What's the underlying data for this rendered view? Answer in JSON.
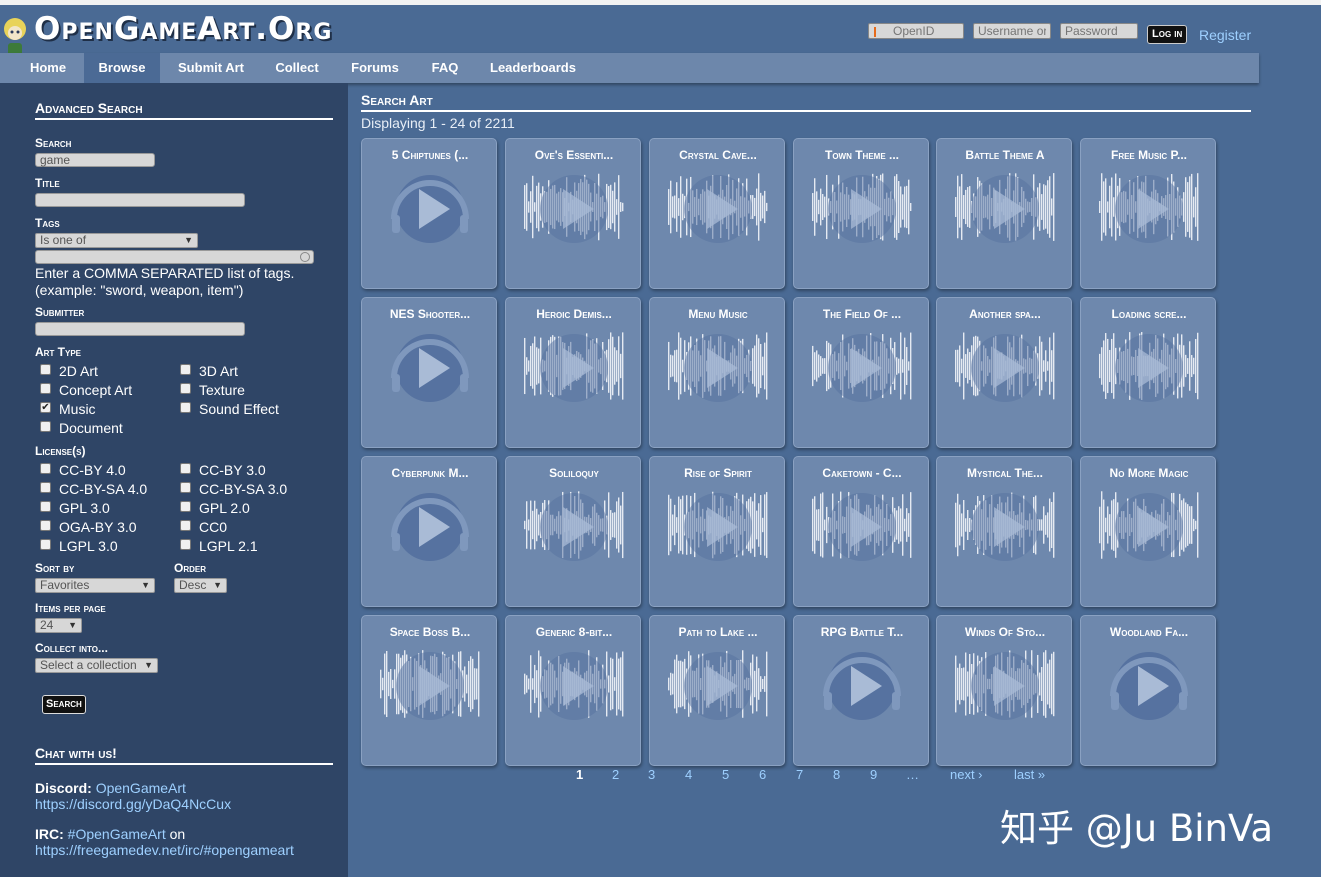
{
  "site": {
    "logo": "OpenGameArt.Org"
  },
  "login": {
    "openid_placeholder": "OpenID",
    "username_placeholder": "Username or",
    "password_placeholder": "Password",
    "login_label": "Log in",
    "register_label": "Register"
  },
  "nav": {
    "items": [
      {
        "label": "Home"
      },
      {
        "label": "Browse"
      },
      {
        "label": "Submit Art"
      },
      {
        "label": "Collect"
      },
      {
        "label": "Forums"
      },
      {
        "label": "FAQ"
      },
      {
        "label": "Leaderboards"
      }
    ],
    "active": "Browse"
  },
  "sidebar": {
    "heading": "Advanced Search",
    "search_label": "Search",
    "search_value": "game",
    "title_label": "Title",
    "title_value": "",
    "tags_label": "Tags",
    "tags_mode": "Is one of",
    "tags_value": "",
    "tags_help_1": "Enter a COMMA SEPARATED list of tags.",
    "tags_help_2": "(example: \"sword, weapon, item\")",
    "submitter_label": "Submitter",
    "submitter_value": "",
    "arttype_label": "Art Type",
    "arttype": [
      {
        "label": "2D Art",
        "checked": false
      },
      {
        "label": "3D Art",
        "checked": false
      },
      {
        "label": "Concept Art",
        "checked": false
      },
      {
        "label": "Texture",
        "checked": false
      },
      {
        "label": "Music",
        "checked": true
      },
      {
        "label": "Sound Effect",
        "checked": false
      },
      {
        "label": "Document",
        "checked": false
      }
    ],
    "license_label": "License(s)",
    "licenses": [
      {
        "label": "CC-BY 4.0"
      },
      {
        "label": "CC-BY 3.0"
      },
      {
        "label": "CC-BY-SA 4.0"
      },
      {
        "label": "CC-BY-SA 3.0"
      },
      {
        "label": "GPL 3.0"
      },
      {
        "label": "GPL 2.0"
      },
      {
        "label": "OGA-BY 3.0"
      },
      {
        "label": "CC0"
      },
      {
        "label": "LGPL 3.0"
      },
      {
        "label": "LGPL 2.1"
      }
    ],
    "sortby_label": "Sort by",
    "sortby_value": "Favorites",
    "order_label": "Order",
    "order_value": "Desc",
    "items_label": "Items per page",
    "items_value": "24",
    "collect_label": "Collect into...",
    "collect_value": "Select a collection",
    "search_button": "Search",
    "chat_heading": "Chat with us!",
    "discord_label": "Discord:",
    "discord_name": "OpenGameArt",
    "discord_url": "https://discord.gg/yDaQ4NcCux",
    "irc_label": "IRC:",
    "irc_channel": "#OpenGameArt",
    "irc_on": "on",
    "irc_url": "https://freegamedev.net/irc/#opengameart"
  },
  "main": {
    "title": "Search Art",
    "displaying": "Displaying 1 - 24 of 2211",
    "cards": [
      {
        "title": "5 Chiptunes (...",
        "waveform": false
      },
      {
        "title": "Ove's Essenti...",
        "waveform": true
      },
      {
        "title": "Crystal Cave...",
        "waveform": true
      },
      {
        "title": "Town Theme ...",
        "waveform": true
      },
      {
        "title": "Battle Theme A",
        "waveform": true
      },
      {
        "title": "Free Music P...",
        "waveform": true
      },
      {
        "title": "NES Shooter...",
        "waveform": false
      },
      {
        "title": "Heroic Demis...",
        "waveform": true
      },
      {
        "title": "Menu Music",
        "waveform": true
      },
      {
        "title": "The Field Of ...",
        "waveform": true
      },
      {
        "title": "Another spa...",
        "waveform": true
      },
      {
        "title": "Loading scre...",
        "waveform": true
      },
      {
        "title": "Cyberpunk M...",
        "waveform": false
      },
      {
        "title": "Soliloquy",
        "waveform": true
      },
      {
        "title": "Rise of Spirit",
        "waveform": true
      },
      {
        "title": "Caketown - C...",
        "waveform": true
      },
      {
        "title": "Mystical The...",
        "waveform": true
      },
      {
        "title": "No More Magic",
        "waveform": true
      },
      {
        "title": "Space Boss B...",
        "waveform": true
      },
      {
        "title": "Generic 8-bit...",
        "waveform": true
      },
      {
        "title": "Path to Lake ...",
        "waveform": true
      },
      {
        "title": "RPG Battle T...",
        "waveform": false
      },
      {
        "title": "Winds Of Sto...",
        "waveform": true
      },
      {
        "title": "Woodland Fa...",
        "waveform": false
      }
    ],
    "pager": {
      "pages": [
        "1",
        "2",
        "3",
        "4",
        "5",
        "6",
        "7",
        "8",
        "9",
        "…"
      ],
      "current": "1",
      "next": "next ›",
      "last": "last »"
    }
  },
  "watermark": "知乎 @Ju BinVa",
  "colors": {
    "background": "#4a6a94",
    "sidebar": "#2f4566",
    "nav": "#6d87ab",
    "card": "#6e88ad",
    "link": "#9ed0ff"
  }
}
